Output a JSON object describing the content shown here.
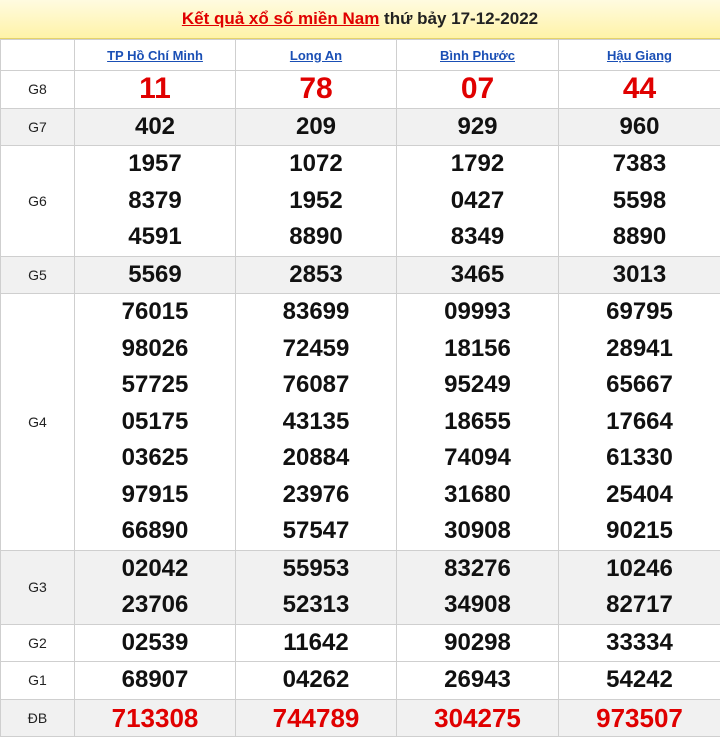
{
  "header": {
    "title_link": "Kết quả xổ số miền Nam",
    "title_rest": "thứ bảy 17-12-2022"
  },
  "provinces": [
    "TP Hồ Chí Minh",
    "Long An",
    "Bình Phước",
    "Hậu Giang"
  ],
  "prizes": [
    {
      "label": "G8",
      "results": [
        [
          "11"
        ],
        [
          "78"
        ],
        [
          "07"
        ],
        [
          "44"
        ]
      ]
    },
    {
      "label": "G7",
      "results": [
        [
          "402"
        ],
        [
          "209"
        ],
        [
          "929"
        ],
        [
          "960"
        ]
      ]
    },
    {
      "label": "G6",
      "results": [
        [
          "1957",
          "8379",
          "4591"
        ],
        [
          "1072",
          "1952",
          "8890"
        ],
        [
          "1792",
          "0427",
          "8349"
        ],
        [
          "7383",
          "5598",
          "8890"
        ]
      ]
    },
    {
      "label": "G5",
      "results": [
        [
          "5569"
        ],
        [
          "2853"
        ],
        [
          "3465"
        ],
        [
          "3013"
        ]
      ]
    },
    {
      "label": "G4",
      "results": [
        [
          "76015",
          "98026",
          "57725",
          "05175",
          "03625",
          "97915",
          "66890"
        ],
        [
          "83699",
          "72459",
          "76087",
          "43135",
          "20884",
          "23976",
          "57547"
        ],
        [
          "09993",
          "18156",
          "95249",
          "18655",
          "74094",
          "31680",
          "30908"
        ],
        [
          "69795",
          "28941",
          "65667",
          "17664",
          "61330",
          "25404",
          "90215"
        ]
      ]
    },
    {
      "label": "G3",
      "results": [
        [
          "02042",
          "23706"
        ],
        [
          "55953",
          "52313"
        ],
        [
          "83276",
          "34908"
        ],
        [
          "10246",
          "82717"
        ]
      ]
    },
    {
      "label": "G2",
      "results": [
        [
          "02539"
        ],
        [
          "11642"
        ],
        [
          "90298"
        ],
        [
          "33334"
        ]
      ]
    },
    {
      "label": "G1",
      "results": [
        [
          "68907"
        ],
        [
          "04262"
        ],
        [
          "26943"
        ],
        [
          "54242"
        ]
      ]
    },
    {
      "label": "ĐB",
      "results": [
        [
          "713308"
        ],
        [
          "744789"
        ],
        [
          "304275"
        ],
        [
          "973507"
        ]
      ]
    }
  ],
  "colors": {
    "accent": "#e00000",
    "link": "#1a4fb5",
    "header_bg": "#fff3a8"
  }
}
